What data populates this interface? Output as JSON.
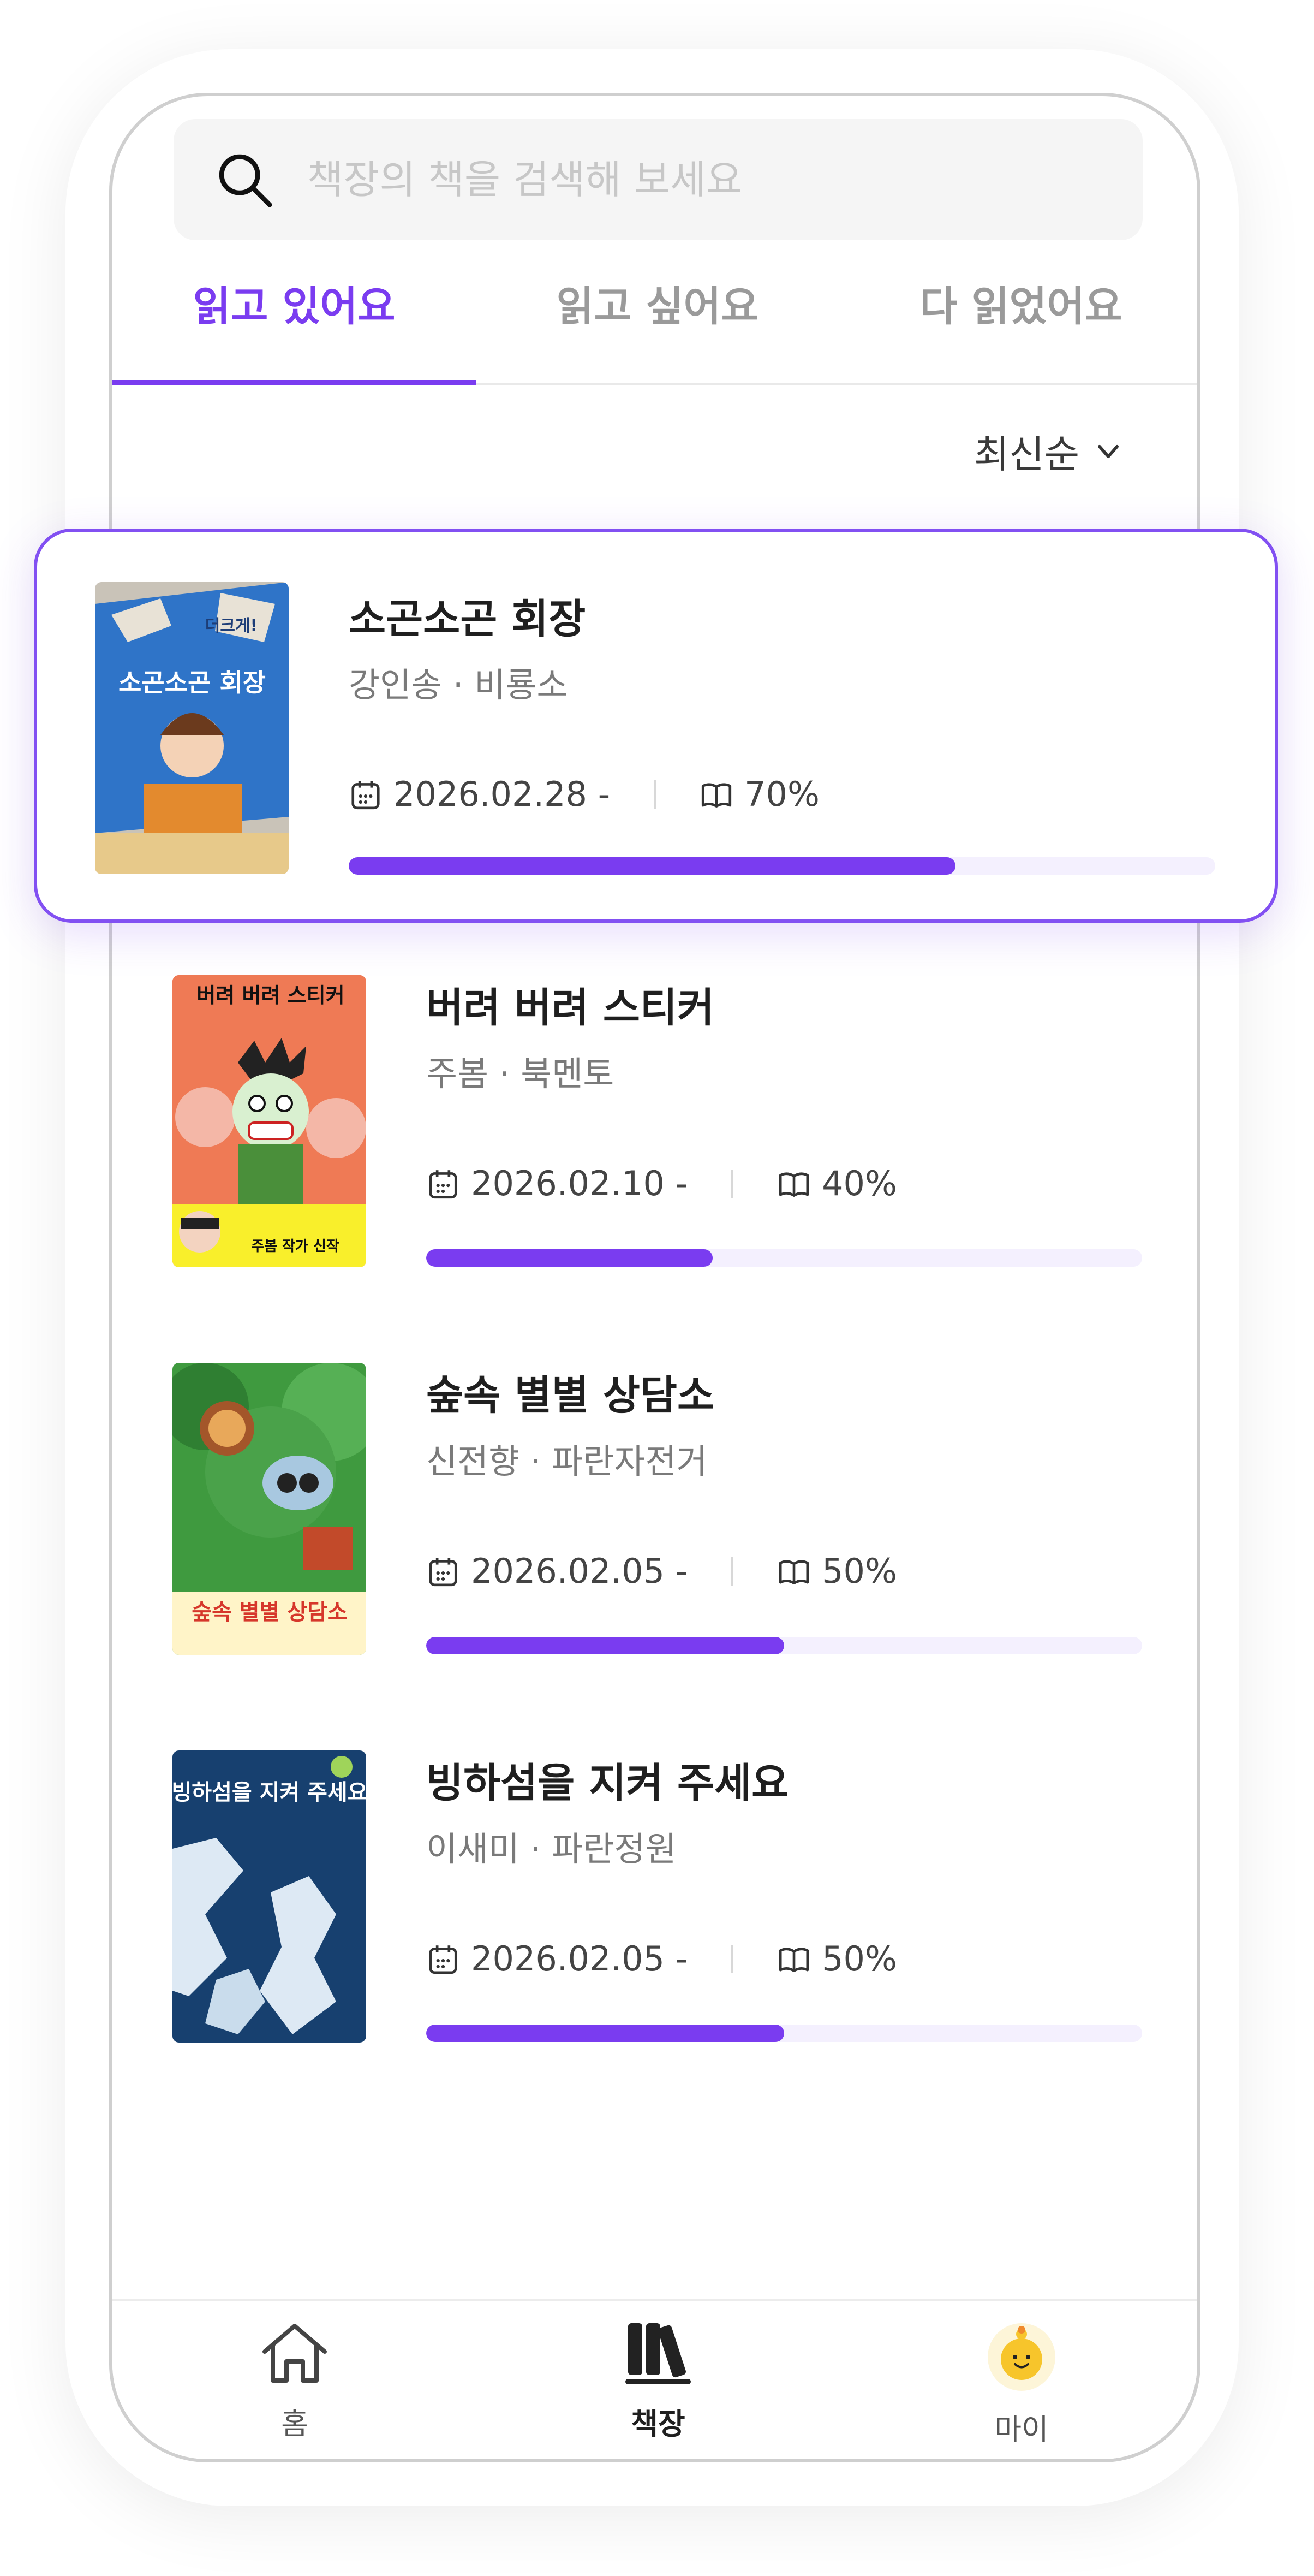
{
  "search": {
    "placeholder": "책장의 책을 검색해 보세요",
    "icon": "search-icon"
  },
  "tabs": [
    {
      "label": "읽고 있어요",
      "active": true
    },
    {
      "label": "읽고 싶어요",
      "active": false
    },
    {
      "label": "다 읽었어요",
      "active": false
    }
  ],
  "sort": {
    "label": "최신순",
    "icon": "chevron-down-icon"
  },
  "books": [
    {
      "title": "소곤소곤 회장",
      "author": "강인송 · 비룡소",
      "date": "2026.02.28 -",
      "progress_label": "70%",
      "progress": 0.7
    },
    {
      "title": "버려 버려 스티커",
      "author": "주봄 · 북멘토",
      "date": "2026.02.10 -",
      "progress_label": "40%",
      "progress": 0.4
    },
    {
      "title": "숲속 별별 상담소",
      "author": "신전향 · 파란자전거",
      "date": "2026.02.05 -",
      "progress_label": "50%",
      "progress": 0.5
    },
    {
      "title": "빙하섬을 지켜 주세요",
      "author": "이새미 · 파란정원",
      "date": "2026.02.05 -",
      "progress_label": "50%",
      "progress": 0.5
    }
  ],
  "covers": [
    {
      "cover_text": "소곤소곤 회장",
      "badge_text": "더크게!"
    },
    {
      "cover_text": "버려 버려 스티커",
      "banner_text": "주봄 작가 신작"
    },
    {
      "cover_text": "숲속 별별 상담소"
    },
    {
      "cover_text": "빙하섬을 지켜 주세요"
    }
  ],
  "nav": [
    {
      "label": "홈",
      "icon": "home-icon",
      "active": false
    },
    {
      "label": "책장",
      "icon": "bookshelf-icon",
      "active": true
    },
    {
      "label": "마이",
      "icon": "profile-avatar-icon",
      "active": false
    }
  ],
  "colors": {
    "accent": "#7a3cf0",
    "progress_track": "#f4f0fe",
    "muted": "#9a9a9a"
  }
}
